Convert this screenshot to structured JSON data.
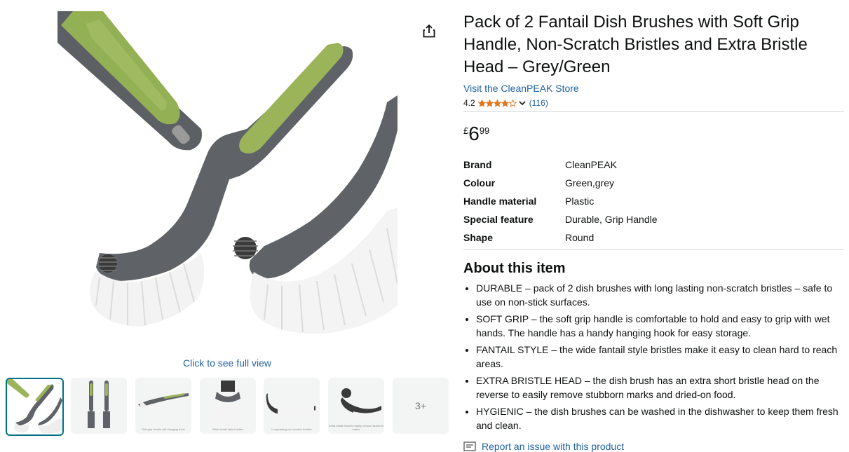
{
  "product": {
    "title": "Pack of 2 Fantail Dish Brushes with Soft Grip Handle, Non-Scratch Bristles and Extra Bristle Head – Grey/Green",
    "store_link": "Visit the CleanPEAK Store",
    "rating": "4.2",
    "rating_value": 4.2,
    "rating_count": "(116)",
    "price": {
      "symbol": "£",
      "whole": "6",
      "fraction": "99"
    }
  },
  "media": {
    "full_view_label": "Click to see full view",
    "share_icon": "share-icon",
    "thumbnails": [
      {
        "caption": ""
      },
      {
        "caption": ""
      },
      {
        "caption": "Soft grip handle with hanging hook"
      },
      {
        "caption": "Wide fantail style bristles"
      },
      {
        "caption": "Long lasting non-scratch bristles"
      },
      {
        "caption": "Extra bristle head to easily remove stubborn marks"
      }
    ],
    "more_label": "3+"
  },
  "specs": [
    {
      "key": "Brand",
      "value": "CleanPEAK"
    },
    {
      "key": "Colour",
      "value": "Green,grey"
    },
    {
      "key": "Handle material",
      "value": "Plastic"
    },
    {
      "key": "Special feature",
      "value": "Durable, Grip Handle"
    },
    {
      "key": "Shape",
      "value": "Round"
    }
  ],
  "about": {
    "heading": "About this item",
    "bullets": [
      "DURABLE – pack of 2 dish brushes with long lasting non-scratch bristles – safe to use on non-stick surfaces.",
      "SOFT GRIP – the soft grip handle is comfortable to hold and easy to grip with wet hands. The handle has a handy hanging hook for easy storage.",
      "FANTAIL STYLE – the wide fantail style bristles make it easy to clean hard to reach areas.",
      "EXTRA BRISTLE HEAD – the dish brush has an extra short bristle head on the reverse to easily remove stubborn marks and dried-on food.",
      "HYGIENIC – the dish brushes can be washed in the dishwasher to keep them fresh and clean."
    ]
  },
  "report_label": "Report an issue with this product",
  "colors": {
    "link": "#2162a1",
    "star": "#de7921",
    "selected_border": "#007185",
    "brush_grey": "#5f6368",
    "brush_green": "#9bb45a"
  }
}
